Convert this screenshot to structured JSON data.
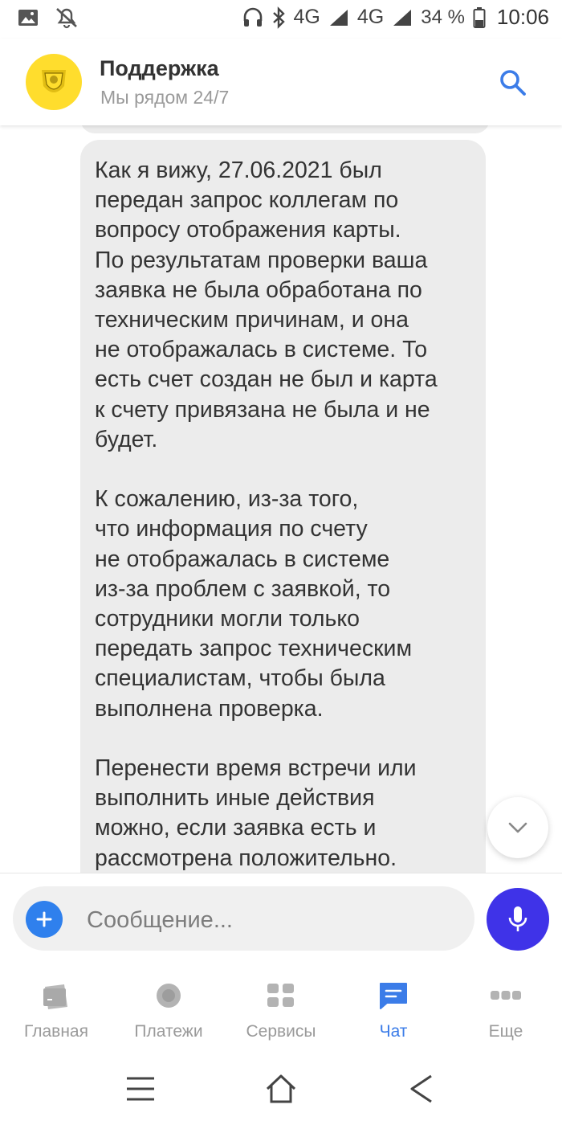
{
  "status_bar": {
    "time": "10:06",
    "battery": "34 %",
    "network1": "4G",
    "network2": "4G"
  },
  "header": {
    "title": "Поддержка",
    "subtitle": "Мы рядом 24/7"
  },
  "message": {
    "text": "Как я вижу, 27.06.2021 был\nпередан запрос коллегам по\nвопросу отображения карты.\nПо результатам проверки ваша\nзаявка не была обработана по\nтехническим причинам, и она\nне отображалась в системе. То\nесть счет создан не был и карта\nк счету привязана не была и не\nбудет.\n\nК сожалению, из-за того,\nчто информация по счету\nне отображалась в системе\nиз-за проблем с заявкой, то\nсотрудники могли только\nпередать запрос техническим\nспециалистам, чтобы была\nвыполнена проверка.\n\nПеренести время встречи или\nвыполнить иные действия\nможно, если заявка есть и\nрассмотрена положительно."
  },
  "composer": {
    "placeholder": "Сообщение..."
  },
  "tabs": [
    {
      "label": "Главная",
      "icon": "card-icon",
      "active": false
    },
    {
      "label": "Платежи",
      "icon": "circle-icon",
      "active": false
    },
    {
      "label": "Сервисы",
      "icon": "grid-icon",
      "active": false
    },
    {
      "label": "Чат",
      "icon": "chat-icon",
      "active": true
    },
    {
      "label": "Еще",
      "icon": "more-icon",
      "active": false
    }
  ],
  "colors": {
    "accent": "#3b7ce8",
    "brand_yellow": "#ffdd2d",
    "mic": "#3f33e8",
    "bubble": "#ececec"
  }
}
